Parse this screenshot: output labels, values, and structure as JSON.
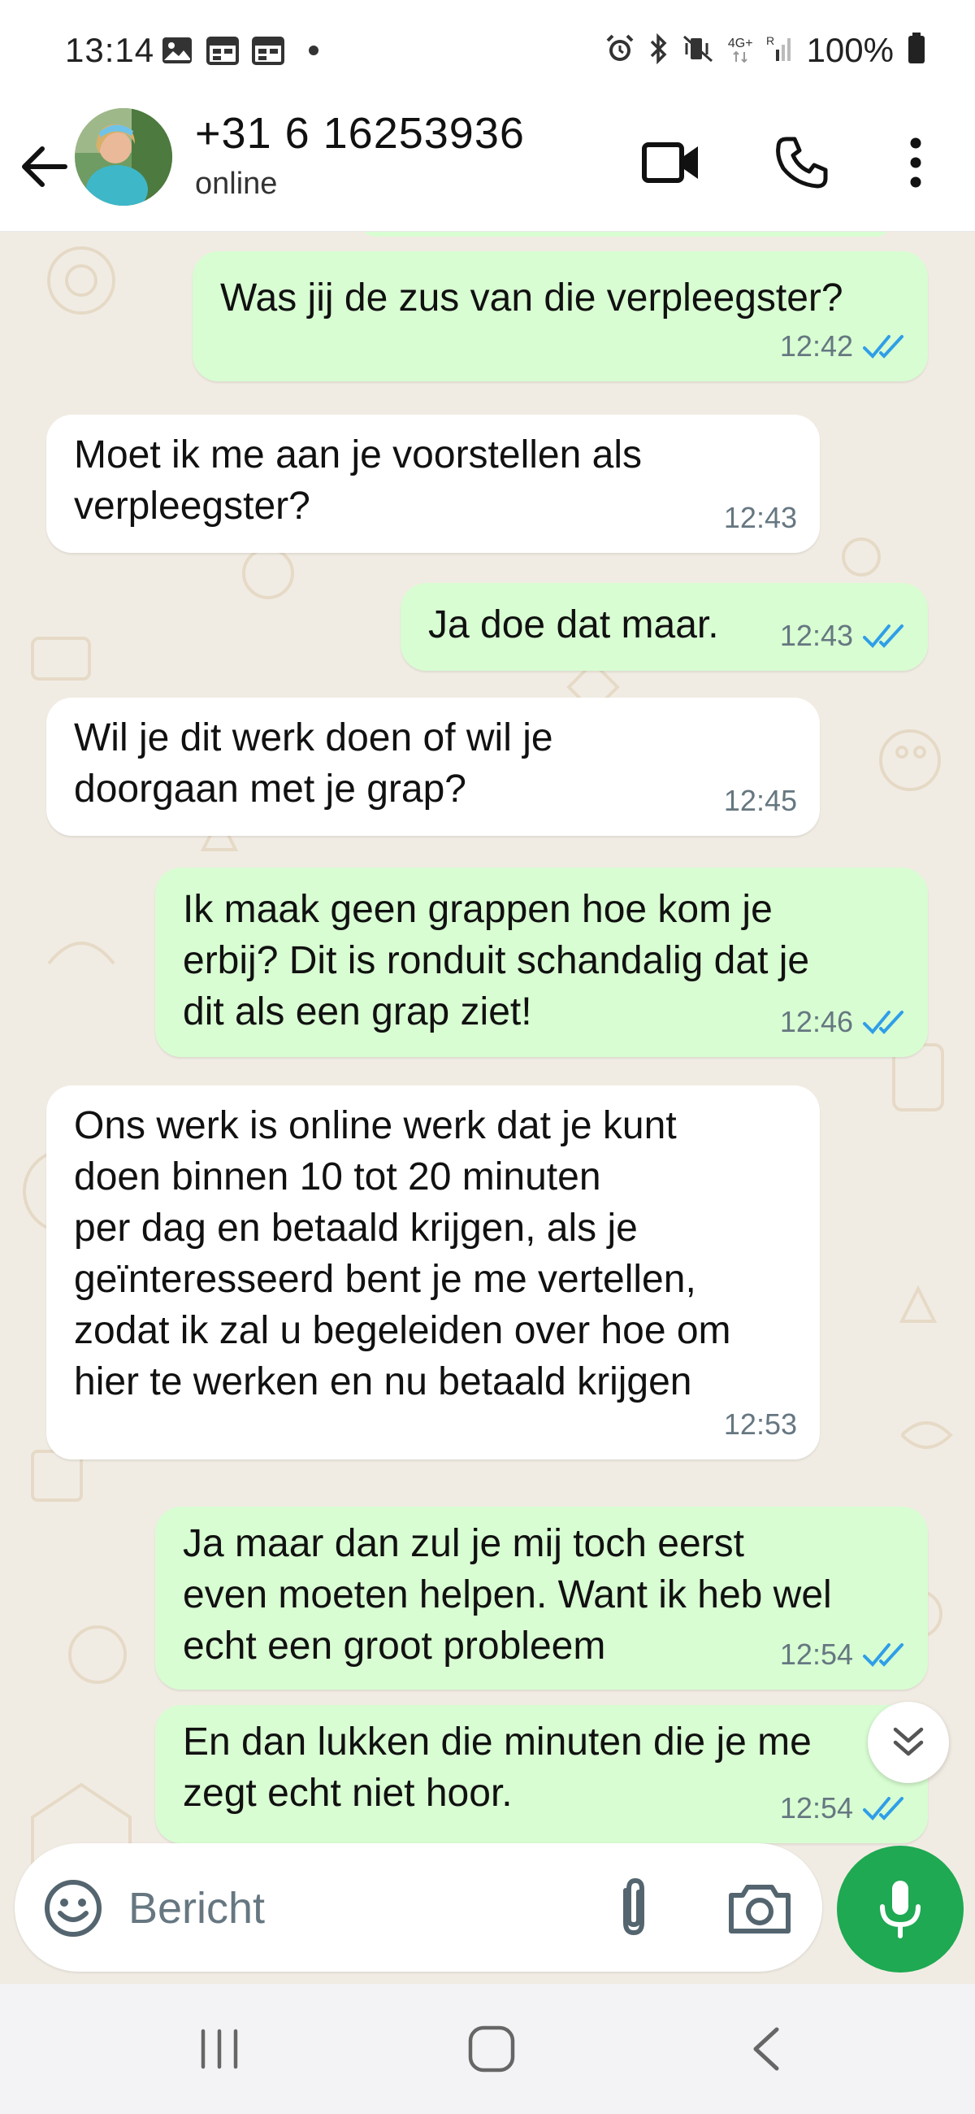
{
  "status_bar": {
    "time": "13:14",
    "left_icons": [
      "gallery-icon",
      "calendar-icon",
      "calendar-icon"
    ],
    "right_icons": [
      "alarm-icon",
      "bluetooth-icon",
      "vibrate-icon",
      "network-4g-icon",
      "signal-icon"
    ],
    "network_label": "4G+",
    "battery_text": "100%"
  },
  "header": {
    "contact_name": "+31 6 16253936",
    "contact_status": "online",
    "icons": [
      "back-arrow-icon",
      "video-call-icon",
      "phone-icon",
      "more-vert-icon"
    ]
  },
  "messages": [
    {
      "direction": "out",
      "text": "Was jij de zus van die verpleegster?",
      "time": "12:42",
      "status": "read"
    },
    {
      "direction": "in",
      "text": "Moet ik me aan je voorstellen als\nverpleegster?",
      "time": "12:43"
    },
    {
      "direction": "out",
      "text": "Ja doe dat maar.",
      "time": "12:43",
      "status": "read"
    },
    {
      "direction": "in",
      "text": "Wil je dit werk doen of wil je\ndoorgaan met je grap?",
      "time": "12:45"
    },
    {
      "direction": "out",
      "text": "Ik maak geen grappen hoe kom je\nerbij? Dit is ronduit schandalig dat je\ndit als een grap ziet!",
      "time": "12:46",
      "status": "read"
    },
    {
      "direction": "in",
      "text": "Ons werk is online werk dat je kunt\ndoen binnen 10 tot 20 minuten\nper dag en betaald krijgen, als je\ngeïnteresseerd bent je me vertellen,\nzodat ik zal u begeleiden over hoe om\nhier te werken en nu betaald krijgen",
      "time": "12:53"
    },
    {
      "direction": "out",
      "text": "Ja maar dan zul je mij toch eerst\neven moeten helpen. Want ik heb wel\necht een groot probleem",
      "time": "12:54",
      "status": "read"
    },
    {
      "direction": "out",
      "text": "En dan lukken die minuten die je me\nzegt echt niet hoor.",
      "time": "12:54",
      "status": "read"
    }
  ],
  "composer": {
    "placeholder": "Bericht",
    "icons": [
      "emoji-icon",
      "attach-icon",
      "camera-icon",
      "mic-icon"
    ]
  },
  "nav": {
    "icons": [
      "recents-icon",
      "home-icon",
      "back-icon"
    ]
  },
  "colors": {
    "outgoing_bubble": "#d8fdd2",
    "incoming_bubble": "#ffffff",
    "chat_background": "#f1ece3",
    "read_ticks": "#2f9ee8",
    "accent_green": "#1ea952"
  }
}
